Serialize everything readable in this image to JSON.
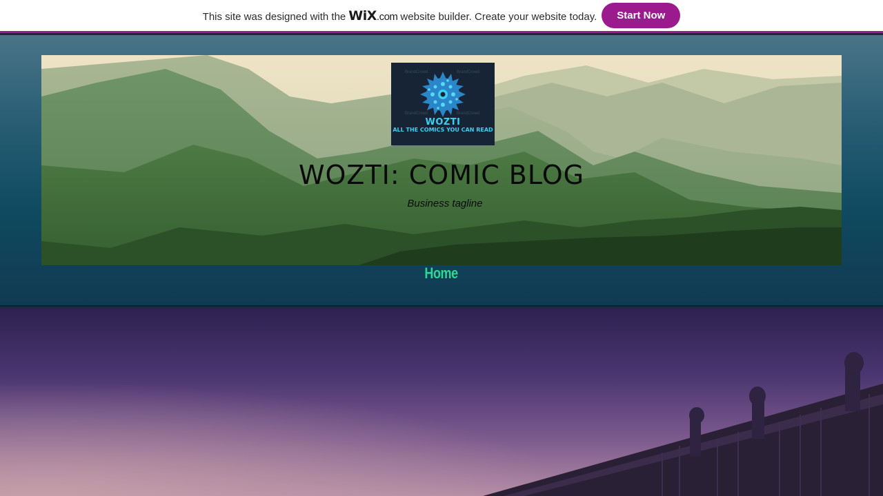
{
  "wix_banner": {
    "text_before": "This site was designed with the",
    "logo": "WiX",
    "logo_suffix": ".com",
    "text_after": "website builder. Create your website today.",
    "button_label": "Start Now",
    "accent_color": "#9b1b8f"
  },
  "header": {
    "logo": {
      "name": "WOZTI",
      "slogan": "ALL THE COMICS YOU CAN READ",
      "watermark": "BrandCrowd",
      "icon": "spiky-gear-icon"
    },
    "site_title": "WOZTI: COMIC BLOG",
    "tagline": "Business tagline",
    "banner_image": "mountains-image"
  },
  "nav": {
    "items": [
      {
        "label": "Home",
        "active": true,
        "color": "#2fd694"
      }
    ]
  },
  "hero": {
    "image": "bridge-sunset-image"
  }
}
